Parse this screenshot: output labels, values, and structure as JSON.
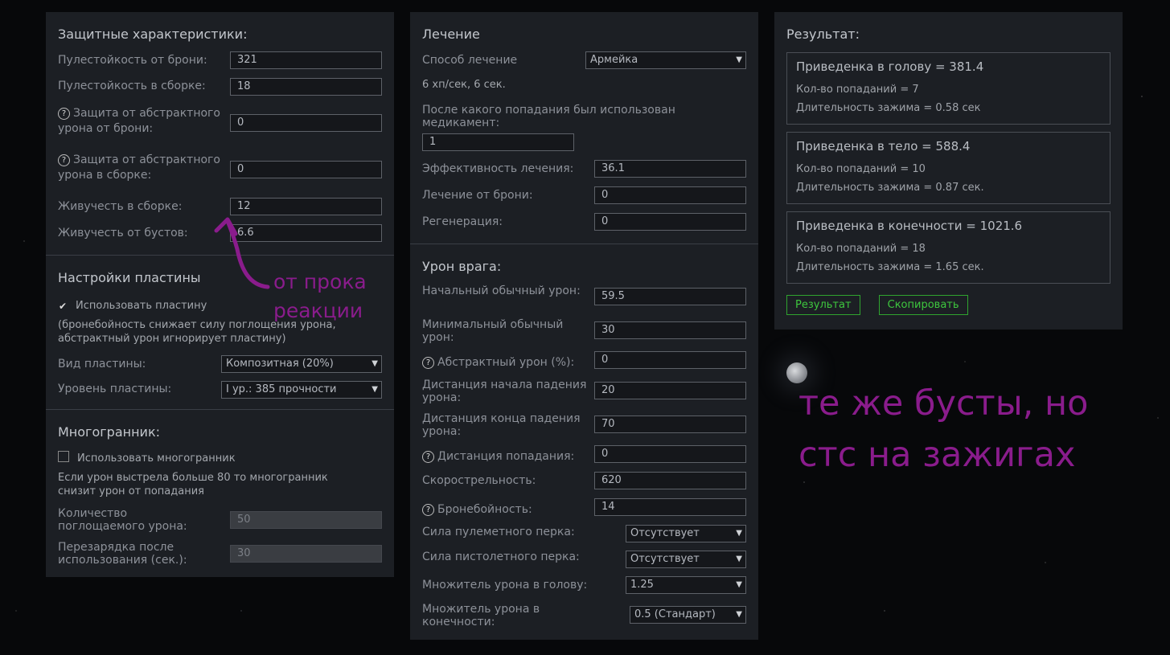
{
  "defense": {
    "title": "Защитные характеристики:",
    "armor_bullet_res_label": "Пулестойкость от брони:",
    "armor_bullet_res_value": "321",
    "build_bullet_res_label": "Пулестойкость в сборке:",
    "build_bullet_res_value": "18",
    "abstract_armor_label": "Защита от абстрактного урона от брони:",
    "abstract_armor_value": "0",
    "abstract_build_label": "Защита от абстрактного урона в сборке:",
    "abstract_build_value": "0",
    "vitality_build_label": "Живучесть в сборке:",
    "vitality_build_value": "12",
    "vitality_boost_label": "Живучесть от бустов:",
    "vitality_boost_value": "6.6"
  },
  "plate": {
    "title": "Настройки пластины",
    "use_label": "Использовать пластину",
    "use_checked": true,
    "note": "(бронебойность снижает силу поглощения урона, абстрактный урон игнорирует пластину)",
    "type_label": "Вид пластины:",
    "type_value": "Композитная (20%)",
    "level_label": "Уровень пластины:",
    "level_value": "I ур.: 385 прочности"
  },
  "polyhedron": {
    "title": "Многогранник:",
    "use_label": "Использовать многогранник",
    "use_checked": false,
    "note": "Если урон выстрела больше 80 то многогранник снизит урон от попадания",
    "absorb_label": "Количество поглощаемого урона:",
    "absorb_value": "50",
    "reload_label": "Перезарядка после использования (сек.):",
    "reload_value": "30"
  },
  "healing": {
    "title": "Лечение",
    "method_label": "Способ лечение",
    "method_value": "Армейка",
    "method_info": "6 хп/сек, 6 сек.",
    "after_hit_label": "После какого попадания был использован медикамент:",
    "after_hit_value": "1",
    "efficiency_label": "Эффективность лечения:",
    "efficiency_value": "36.1",
    "armor_heal_label": "Лечение от брони:",
    "armor_heal_value": "0",
    "regen_label": "Регенерация:",
    "regen_value": "0"
  },
  "enemy": {
    "title": "Урон врага:",
    "base_damage_label": "Начальный обычный урон:",
    "base_damage_value": "59.5",
    "min_damage_label": "Минимальный обычный урон:",
    "min_damage_value": "30",
    "abstract_damage_label": "Абстрактный урон (%):",
    "abstract_damage_value": "0",
    "falloff_start_label": "Дистанция начала падения урона:",
    "falloff_start_value": "20",
    "falloff_end_label": "Дистанция конца падения урона:",
    "falloff_end_value": "70",
    "hit_distance_label": "Дистанция попадания:",
    "hit_distance_value": "0",
    "fire_rate_label": "Скорострельность:",
    "fire_rate_value": "620",
    "penetration_label": "Бронебойность:",
    "penetration_value": "14",
    "mg_perk_label": "Сила пулеметного перка:",
    "mg_perk_value": "Отсутствует",
    "pistol_perk_label": "Сила пистолетного перка:",
    "pistol_perk_value": "Отсутствует",
    "head_mult_label": "Множитель урона в голову:",
    "head_mult_value": "1.25",
    "limb_mult_label": "Множитель урона в конечности:",
    "limb_mult_value": "0.5 (Стандарт)"
  },
  "result": {
    "title": "Результат:",
    "boxes": [
      {
        "title": "Приведенка в голову = 381.4",
        "hits": "Кол-во попаданий = 7",
        "duration": "Длительность зажима = 0.58 сек"
      },
      {
        "title": "Приведенка в тело = 588.4",
        "hits": "Кол-во попаданий = 10",
        "duration": "Длительность зажима = 0.87 сек."
      },
      {
        "title": "Приведенка в конечности = 1021.6",
        "hits": "Кол-во попаданий = 18",
        "duration": "Длительность зажима = 1.65 сек."
      }
    ],
    "result_button": "Результат",
    "copy_button": "Скопировать"
  },
  "annotations": {
    "arrow_text_line1": "от прока",
    "arrow_text_line2": "реакции",
    "big_text_line1": "те же бусты, но",
    "big_text_line2": "стс на зажигах",
    "color": "#8a1c8c"
  }
}
